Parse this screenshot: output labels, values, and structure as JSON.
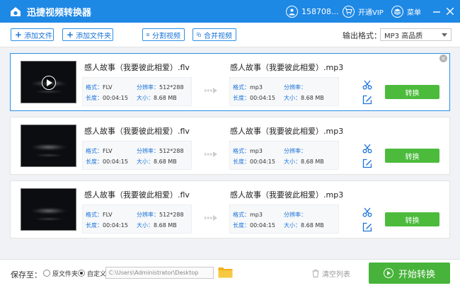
{
  "app": {
    "title": "迅捷视频转换器",
    "accent_color": "#1e88e5",
    "convert_color": "#4cbb3c"
  },
  "titlebar": {
    "user": "158708...",
    "vip": "开通VIP",
    "menu": "菜单",
    "icons": [
      "user-icon",
      "cart-icon",
      "menu-icon",
      "minimize-icon",
      "close-icon"
    ]
  },
  "toolbar": {
    "add_file": "添加文件",
    "add_folder": "添加文件夹",
    "split_video": "分割视频",
    "merge_video": "合并视频",
    "format_label": "输出格式：",
    "format_value": "MP3  高品质"
  },
  "labels": {
    "format": "格式：",
    "resolution": "分辨率：",
    "duration": "长度：",
    "size": "大小：",
    "convert": "转换"
  },
  "files": [
    {
      "src_name": "感人故事（我要彼此相爱）.flv",
      "src_format": "FLV",
      "src_resolution": "512*288",
      "src_duration": "00:04:15",
      "src_size": "8.68 MB",
      "dst_name": "感人故事（我要彼此相爱）.mp3",
      "dst_format": "mp3",
      "dst_resolution": "",
      "dst_duration": "00:04:15",
      "dst_size": "8.68 MB",
      "selected": true
    },
    {
      "src_name": "感人故事（我要彼此相爱）.flv",
      "src_format": "FLV",
      "src_resolution": "512*288",
      "src_duration": "00:04:15",
      "src_size": "8.68 MB",
      "dst_name": "感人故事（我要彼此相爱）.mp3",
      "dst_format": "mp3",
      "dst_resolution": "",
      "dst_duration": "00:04:15",
      "dst_size": "8.68 MB",
      "selected": false
    },
    {
      "src_name": "感人故事（我要彼此相爱）.flv",
      "src_format": "FLV",
      "src_resolution": "512*288",
      "src_duration": "00:04:15",
      "src_size": "8.68 MB",
      "dst_name": "感人故事（我要彼此相爱）.mp3",
      "dst_format": "mp3",
      "dst_resolution": "",
      "dst_duration": "00:04:15",
      "dst_size": "8.68 MB",
      "selected": false
    }
  ],
  "bottom": {
    "save_label": "保存至：",
    "option_original": "原文件夹",
    "option_custom": "自定义",
    "path": "C:\\Users\\Administrator\\Desktop",
    "clear_list": "清空列表",
    "start": "开始转换"
  }
}
